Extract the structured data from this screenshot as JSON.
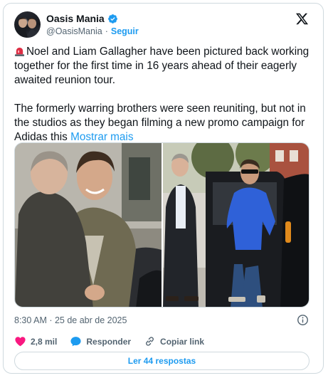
{
  "account": {
    "name": "Oasis Mania",
    "handle": "@OasisMania",
    "separator": "·",
    "follow_label": "Seguir"
  },
  "tweet": {
    "paragraph1": "Noel and Liam Gallagher have been pictured back working together for the first time in 16 years ahead of their eagerly awaited reunion tour.",
    "paragraph2": "The formerly warring brothers were seen reuniting, but not in the studios as they began filming a new promo campaign for Adidas this",
    "show_more": "Mostrar mais",
    "emoji": "rotating-light-icon"
  },
  "meta": {
    "timestamp": "8:30 AM · 25 de abr de 2025"
  },
  "actions": {
    "likes": "2,8 mil",
    "reply_label": "Responder",
    "copy_link_label": "Copiar link",
    "read_replies_label": "Ler 44 respostas"
  },
  "colors": {
    "accent": "#1d9bf0",
    "like": "#f91880",
    "text": "#0f1419",
    "muted": "#536471",
    "border": "#cfd9de"
  }
}
